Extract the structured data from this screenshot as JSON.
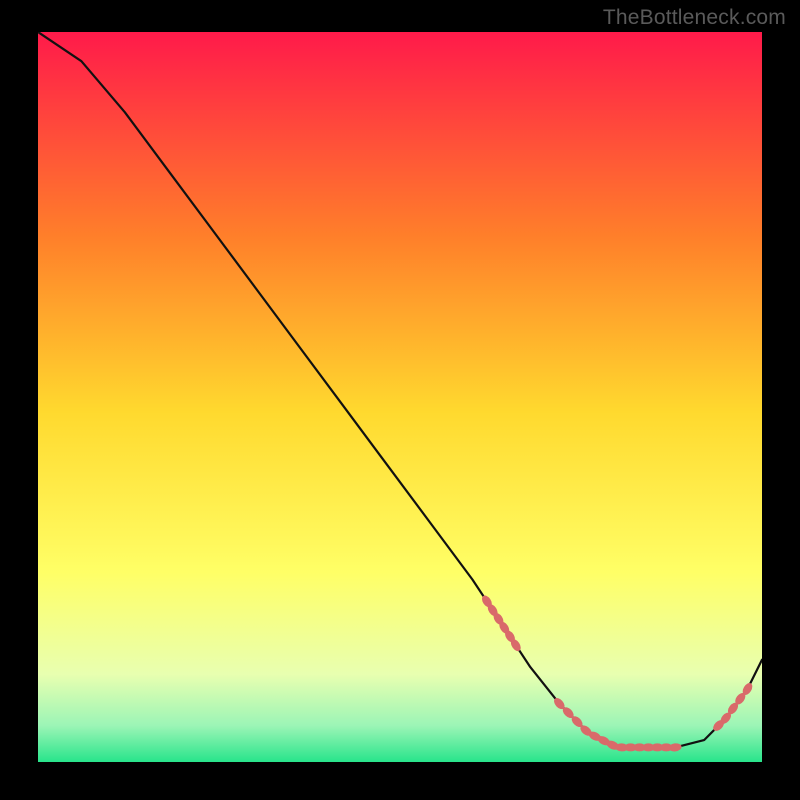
{
  "watermark": "TheBottleneck.com",
  "colors": {
    "bg": "#000000",
    "line": "#111111",
    "marker": "#d96a6a",
    "grad_top": "#ff1a4a",
    "grad_mid1": "#ff7f2a",
    "grad_mid2": "#ffd92e",
    "grad_mid3": "#ffff66",
    "grad_mid4": "#e8ffb0",
    "grad_mid5": "#9cf5b6",
    "grad_bottom": "#28e48b"
  },
  "chart_data": {
    "type": "line",
    "title": "",
    "xlabel": "",
    "ylabel": "",
    "xlim": [
      0,
      100
    ],
    "ylim": [
      0,
      100
    ],
    "series": [
      {
        "name": "curve",
        "x": [
          0,
          6,
          12,
          18,
          24,
          30,
          36,
          42,
          48,
          54,
          60,
          64,
          68,
          72,
          76,
          80,
          84,
          88,
          92,
          95,
          98,
          100
        ],
        "y": [
          100,
          96,
          89,
          81,
          73,
          65,
          57,
          49,
          41,
          33,
          25,
          19,
          13,
          8,
          4,
          2,
          2,
          2,
          3,
          6,
          10,
          14
        ]
      }
    ],
    "markers": [
      {
        "segment": "descent",
        "x_range": [
          62,
          66
        ],
        "count": 6
      },
      {
        "segment": "floor",
        "x_range": [
          72,
          88
        ],
        "count": 14
      },
      {
        "segment": "ascent",
        "x_range": [
          94,
          98
        ],
        "count": 5
      }
    ]
  }
}
